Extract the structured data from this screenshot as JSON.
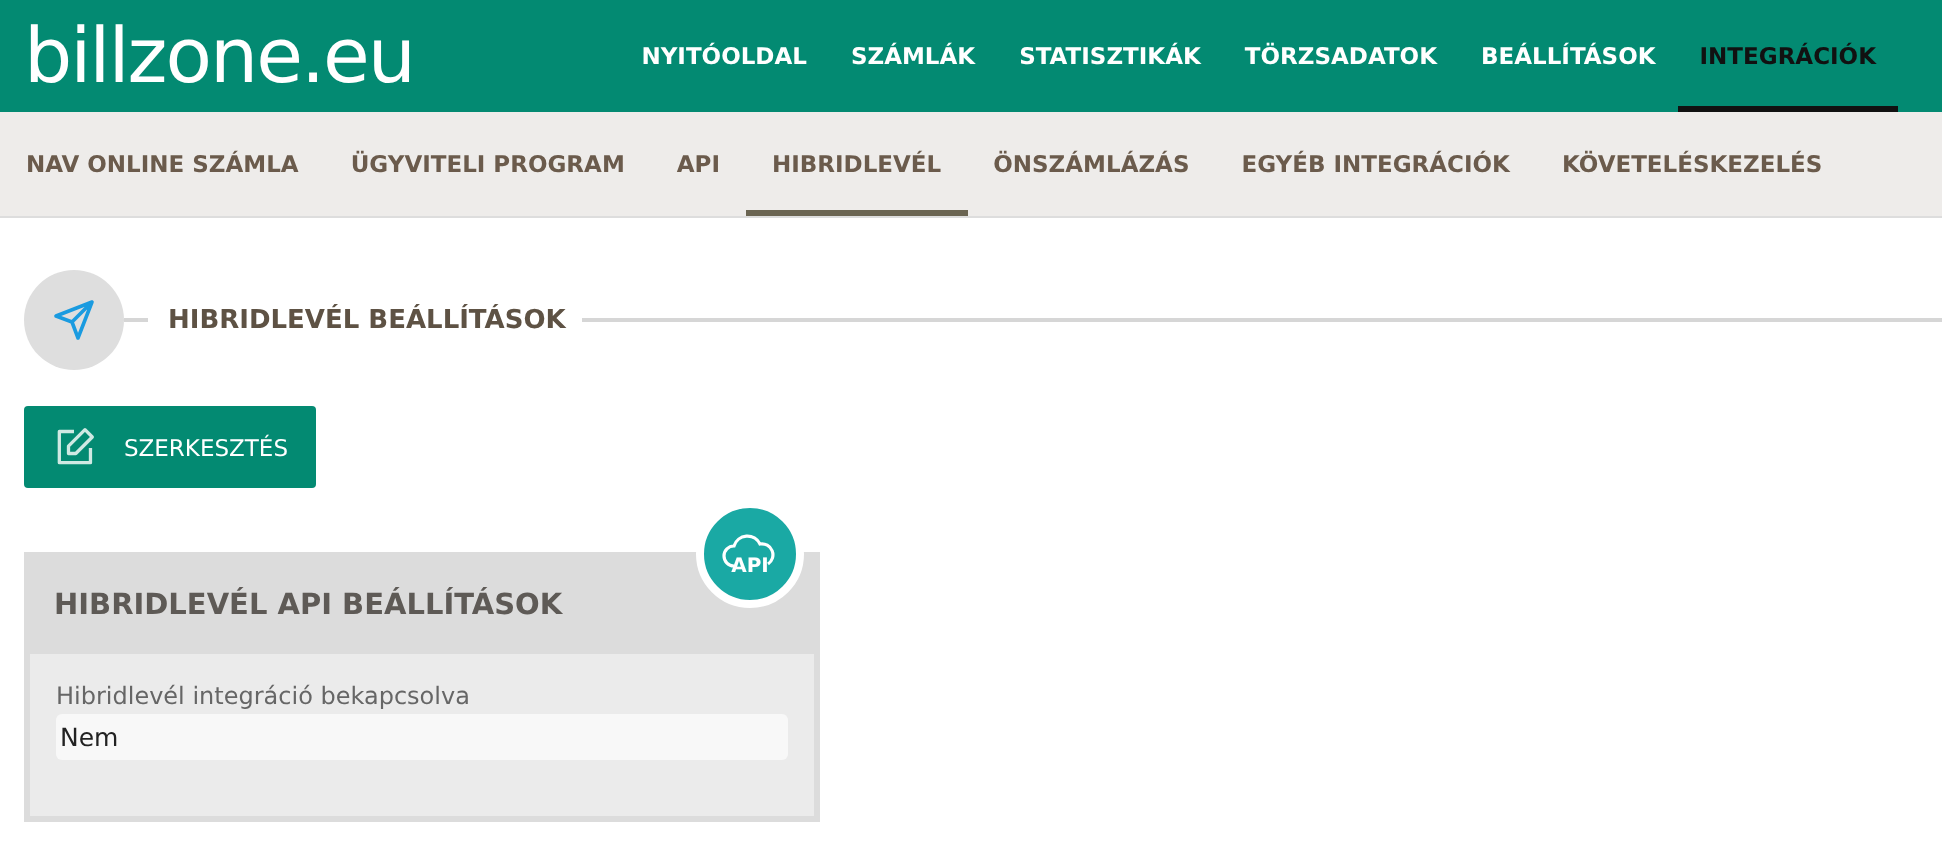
{
  "logo": "billzone.eu",
  "main_nav": [
    {
      "label": "NYITÓOLDAL",
      "selected": false
    },
    {
      "label": "SZÁMLÁK",
      "selected": false
    },
    {
      "label": "STATISZTIKÁK",
      "selected": false
    },
    {
      "label": "TÖRZSADATOK",
      "selected": false
    },
    {
      "label": "BEÁLLÍTÁSOK",
      "selected": false
    },
    {
      "label": "INTEGRÁCIÓK",
      "selected": true
    }
  ],
  "sub_nav": [
    {
      "label": "NAV ONLINE SZÁMLA",
      "selected": false
    },
    {
      "label": "ÜGYVITELI PROGRAM",
      "selected": false
    },
    {
      "label": "API",
      "selected": false
    },
    {
      "label": "HIBRIDLEVÉL",
      "selected": true
    },
    {
      "label": "ÖNSZÁMLÁZÁS",
      "selected": false
    },
    {
      "label": "EGYÉB INTEGRÁCIÓK",
      "selected": false
    },
    {
      "label": "KÖVETELÉSKEZELÉS",
      "selected": false
    }
  ],
  "section_title": "HIBRIDLEVÉL BEÁLLÍTÁSOK",
  "edit_button": "SZERKESZTÉS",
  "card": {
    "title": "HIBRIDLEVÉL API BEÁLLÍTÁSOK",
    "badge": "API",
    "fields": [
      {
        "label": "Hibridlevél integráció bekapcsolva",
        "value": "Nem"
      }
    ]
  }
}
